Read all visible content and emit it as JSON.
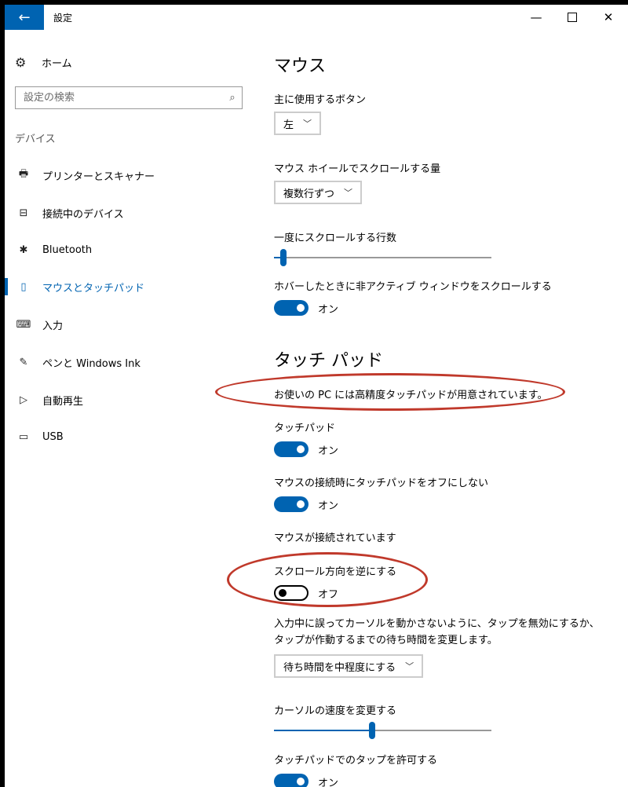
{
  "titlebar": {
    "back_icon": "←",
    "title": "設定",
    "minimize": "—",
    "close": "✕"
  },
  "sidebar": {
    "home": {
      "icon": "⚙",
      "label": "ホーム"
    },
    "search": {
      "placeholder": "設定の検索",
      "icon": "⌕"
    },
    "category": "デバイス",
    "items": [
      {
        "icon": "🖶",
        "label": "プリンターとスキャナー"
      },
      {
        "icon": "⊟",
        "label": "接続中のデバイス"
      },
      {
        "icon": "✱",
        "label": "Bluetooth"
      },
      {
        "icon": "▯",
        "label": "マウスとタッチパッド",
        "active": true
      },
      {
        "icon": "⌨",
        "label": "入力"
      },
      {
        "icon": "✎",
        "label": "ペンと Windows Ink"
      },
      {
        "icon": "▷",
        "label": "自動再生"
      },
      {
        "icon": "▭",
        "label": "USB"
      }
    ]
  },
  "mouse": {
    "heading": "マウス",
    "primary_button_label": "主に使用するボタン",
    "primary_button_value": "左",
    "wheel_scroll_label": "マウス ホイールでスクロールする量",
    "wheel_scroll_value": "複数行ずつ",
    "lines_label": "一度にスクロールする行数",
    "lines_level": 0.03,
    "hover_scroll_label": "ホバーしたときに非アクティブ ウィンドウをスクロールする",
    "hover_scroll_state": "オン"
  },
  "touchpad": {
    "heading": "タッチ パッド",
    "precision_note": "お使いの PC には高精度タッチパッドが用意されています。",
    "touchpad_label": "タッチパッド",
    "touchpad_state": "オン",
    "keep_on_label": "マウスの接続時にタッチパッドをオフにしない",
    "keep_on_state": "オン",
    "mouse_connected": "マウスが接続されています",
    "reverse_label": "スクロール方向を逆にする",
    "reverse_state": "オフ",
    "delay_desc": "入力中に誤ってカーソルを動かさないように、タップを無効にするか、タップが作動するまでの待ち時間を変更します。",
    "delay_value": "待ち時間を中程度にする",
    "cursor_speed_label": "カーソルの速度を変更する",
    "cursor_speed_level": 0.45,
    "tap_label": "タッチパッドでのタップを許可する",
    "tap_state": "オン"
  },
  "colors": {
    "accent": "#0063b1",
    "annotation": "#c0392b"
  },
  "dropdown_chevron": "﹀"
}
